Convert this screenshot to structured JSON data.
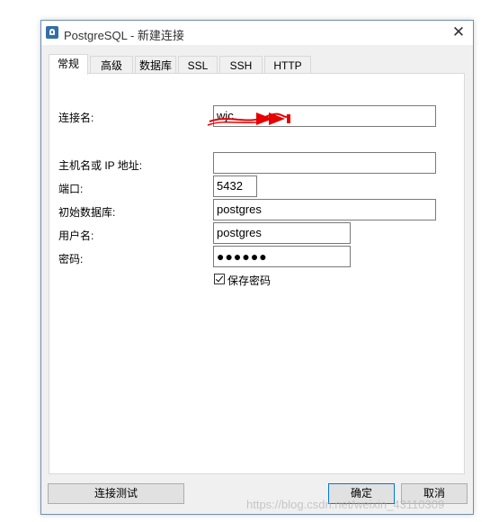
{
  "window": {
    "title": "PostgreSQL - 新建连接"
  },
  "tabs": [
    "常规",
    "高级",
    "数据库",
    "SSL",
    "SSH",
    "HTTP"
  ],
  "form": {
    "connection_name_label": "连接名:",
    "connection_name_value": "wjc",
    "host_label": "主机名或 IP 地址:",
    "host_value": "",
    "port_label": "端口:",
    "port_value": "5432",
    "initial_db_label": "初始数据库:",
    "initial_db_value": "postgres",
    "username_label": "用户名:",
    "username_value": "postgres",
    "password_label": "密码:",
    "password_value": "●●●●●●",
    "save_password_label": "保存密码"
  },
  "buttons": {
    "test": "连接测试",
    "ok": "确定",
    "cancel": "取消"
  },
  "watermark": "https://blog.csdn.net/weixin_43110309",
  "colors": {
    "scribble": "#e60000",
    "primary_border": "#0078d7"
  }
}
